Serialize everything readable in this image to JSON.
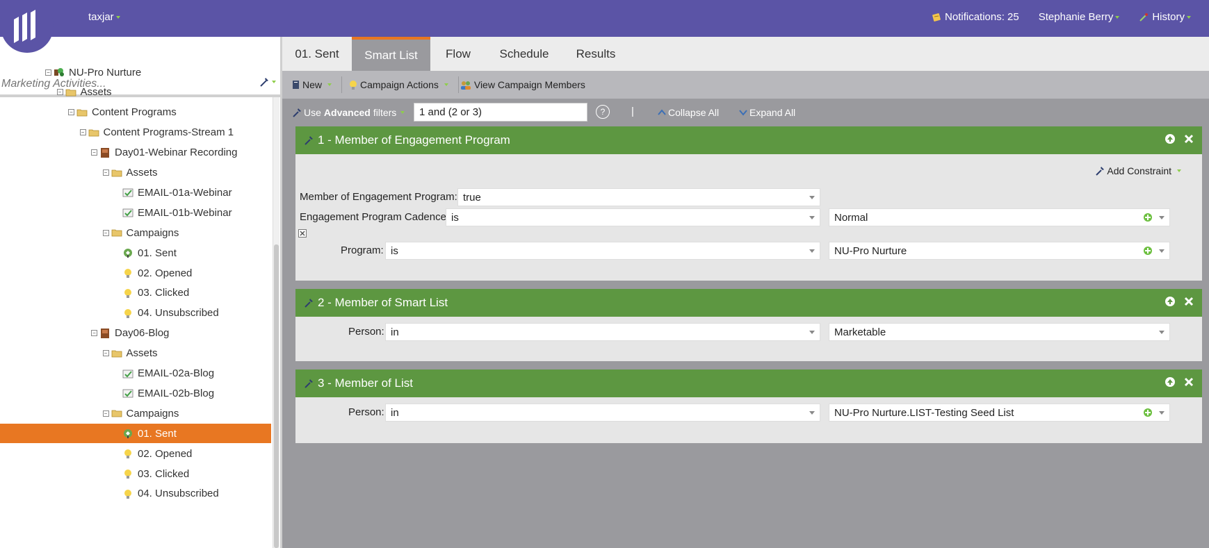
{
  "header": {
    "workspace": "taxjar",
    "notifications": "Notifications: 25",
    "user": "Stephanie Berry",
    "history": "History"
  },
  "search": {
    "placeholder": "Marketing Activities..."
  },
  "tree": [
    {
      "label": "NU-Pro Nurture",
      "indent": 0,
      "icon": "program-icon",
      "expander": true
    },
    {
      "label": "Assets",
      "indent": 1,
      "icon": "folder-icon",
      "expander": true
    },
    {
      "label": "Content Programs",
      "indent": 2,
      "icon": "folder-icon",
      "expander": true
    },
    {
      "label": "Content Programs-Stream 1",
      "indent": 3,
      "icon": "folder-icon",
      "expander": true
    },
    {
      "label": "Day01-Webinar Recording",
      "indent": 4,
      "icon": "program-book-icon",
      "expander": true
    },
    {
      "label": "Assets",
      "indent": 5,
      "icon": "folder-icon",
      "expander": true
    },
    {
      "label": "EMAIL-01a-Webinar",
      "indent": 6,
      "icon": "email-icon",
      "expander": false
    },
    {
      "label": "EMAIL-01b-Webinar",
      "indent": 6,
      "icon": "email-icon",
      "expander": false
    },
    {
      "label": "Campaigns",
      "indent": 5,
      "icon": "folder-icon",
      "expander": true
    },
    {
      "label": "01. Sent",
      "indent": 6,
      "icon": "campaign-active-icon",
      "expander": false
    },
    {
      "label": "02. Opened",
      "indent": 6,
      "icon": "lightbulb-icon",
      "expander": false
    },
    {
      "label": "03. Clicked",
      "indent": 6,
      "icon": "lightbulb-icon",
      "expander": false
    },
    {
      "label": "04. Unsubscribed",
      "indent": 6,
      "icon": "lightbulb-icon",
      "expander": false
    },
    {
      "label": "Day06-Blog",
      "indent": 4,
      "icon": "program-book-icon",
      "expander": true
    },
    {
      "label": "Assets",
      "indent": 5,
      "icon": "folder-icon",
      "expander": true
    },
    {
      "label": "EMAIL-02a-Blog",
      "indent": 6,
      "icon": "email-icon",
      "expander": false
    },
    {
      "label": "EMAIL-02b-Blog",
      "indent": 6,
      "icon": "email-icon",
      "expander": false
    },
    {
      "label": "Campaigns",
      "indent": 5,
      "icon": "folder-icon",
      "expander": true
    },
    {
      "label": "01. Sent",
      "indent": 6,
      "icon": "campaign-active-icon",
      "expander": false,
      "selected": true
    },
    {
      "label": "02. Opened",
      "indent": 6,
      "icon": "lightbulb-icon",
      "expander": false
    },
    {
      "label": "03. Clicked",
      "indent": 6,
      "icon": "lightbulb-icon",
      "expander": false
    },
    {
      "label": "04. Unsubscribed",
      "indent": 6,
      "icon": "lightbulb-icon",
      "expander": false
    }
  ],
  "tabs": [
    "01. Sent",
    "Smart List",
    "Flow",
    "Schedule",
    "Results"
  ],
  "active_tab": "Smart List",
  "toolbar": {
    "new_label": "New",
    "campaign_actions_label": "Campaign Actions",
    "view_members_label": "View Campaign Members"
  },
  "filterbar": {
    "use_label": "Use",
    "advanced_label": "Advanced",
    "filters_label": "filters",
    "logic_value": "1 and (2 or 3)",
    "help_label": "?",
    "pipe": "|",
    "collapse_label": "Collapse All",
    "expand_label": "Expand All"
  },
  "filters": [
    {
      "title": "1 - Member of Engagement Program",
      "add_constraint": "Add Constraint",
      "rows": [
        {
          "label": "Member of Engagement Program:",
          "operator": "true"
        },
        {
          "label": "Engagement Program Cadence:",
          "operator": "is",
          "value": "Normal"
        },
        {
          "label": "Program:",
          "operator": "is",
          "value": "NU-Pro Nurture"
        }
      ]
    },
    {
      "title": "2 - Member of Smart List",
      "rows": [
        {
          "label": "Person:",
          "operator": "in",
          "value": "Marketable"
        }
      ]
    },
    {
      "title": "3 - Member of List",
      "rows": [
        {
          "label": "Person:",
          "operator": "in",
          "value": "NU-Pro Nurture.LIST-Testing Seed List"
        }
      ]
    }
  ],
  "colors": {
    "topbar": "#5b54a6",
    "accent": "#e87722",
    "panel_header": "#5d9741",
    "workspace_bg": "#9a9a9e"
  }
}
